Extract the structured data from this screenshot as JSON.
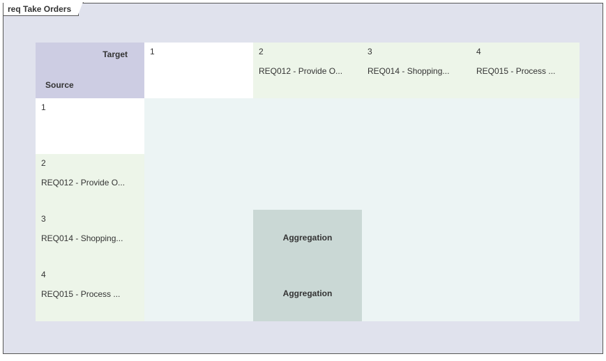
{
  "frame": {
    "title": "req Take Orders"
  },
  "corner": {
    "target_label": "Target",
    "source_label": "Source"
  },
  "columns": [
    {
      "num": "1",
      "label": ""
    },
    {
      "num": "2",
      "label": "REQ012 - Provide O..."
    },
    {
      "num": "3",
      "label": "REQ014 - Shopping..."
    },
    {
      "num": "4",
      "label": "REQ015 - Process ..."
    }
  ],
  "rows": [
    {
      "num": "1",
      "label": ""
    },
    {
      "num": "2",
      "label": "REQ012 - Provide O..."
    },
    {
      "num": "3",
      "label": "REQ014 - Shopping..."
    },
    {
      "num": "4",
      "label": "REQ015 - Process ..."
    }
  ],
  "cells": {
    "r3c2": "Aggregation",
    "r4c2": "Aggregation"
  }
}
